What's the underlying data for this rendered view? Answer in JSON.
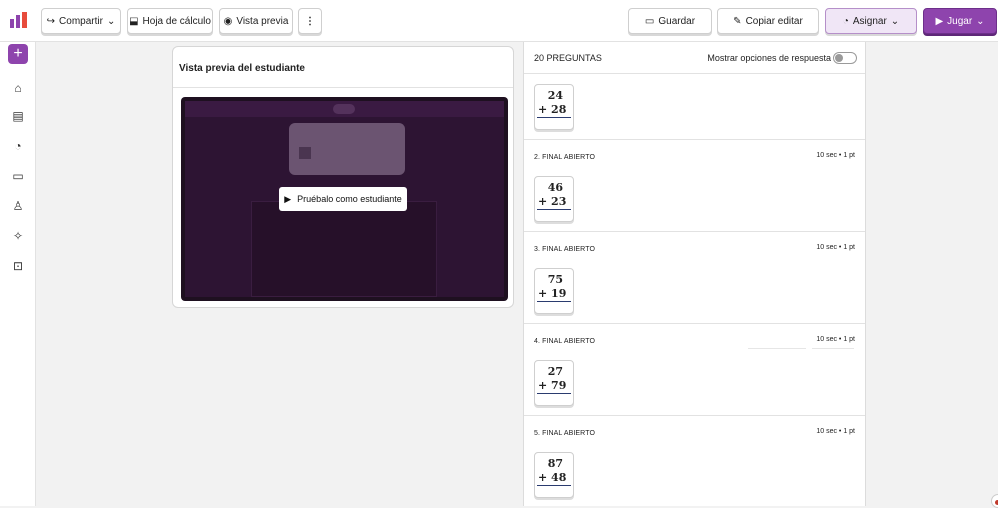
{
  "toolbar": {
    "share_label": "Compartir",
    "sheet_label": "Hoja de cálculo",
    "preview_label": "Vista previa",
    "more_label": "⋮",
    "save_label": "Guardar",
    "copy_edit_label": "Copiar editar",
    "assign_label": "Asignar",
    "play_label": "Jugar"
  },
  "colors": {
    "accent": "#8e44ad",
    "assign_bg": "#f0e6f6",
    "play_bg": "#8e44ad"
  },
  "sidebar": {
    "add": "+",
    "icons": [
      "home-icon",
      "document-icon",
      "chart-icon",
      "presentation-icon",
      "user-icon",
      "sparkle-icon",
      "feedback-icon"
    ]
  },
  "preview": {
    "title": "Vista previa del estudiante",
    "try_button": "Pruébalo como estudiante"
  },
  "questions": {
    "count_label": "20 PREGUNTAS",
    "show_options_label": "Mostrar opciones de respuesta",
    "show_options_on": false,
    "items": [
      {
        "label": "",
        "meta": "",
        "top": "24",
        "bottom": "+ 28"
      },
      {
        "label": "2. FINAL ABIERTO",
        "meta": "10 sec • 1 pt",
        "top": "46",
        "bottom": "+ 23"
      },
      {
        "label": "3. FINAL ABIERTO",
        "meta": "10 sec • 1 pt",
        "top": "75",
        "bottom": "+ 19"
      },
      {
        "label": "4. FINAL ABIERTO",
        "meta": "10 sec • 1 pt",
        "top": "27",
        "bottom": "+ 79"
      },
      {
        "label": "5. FINAL ABIERTO",
        "meta": "10 sec • 1 pt",
        "top": "87",
        "bottom": "+ 48"
      }
    ]
  }
}
